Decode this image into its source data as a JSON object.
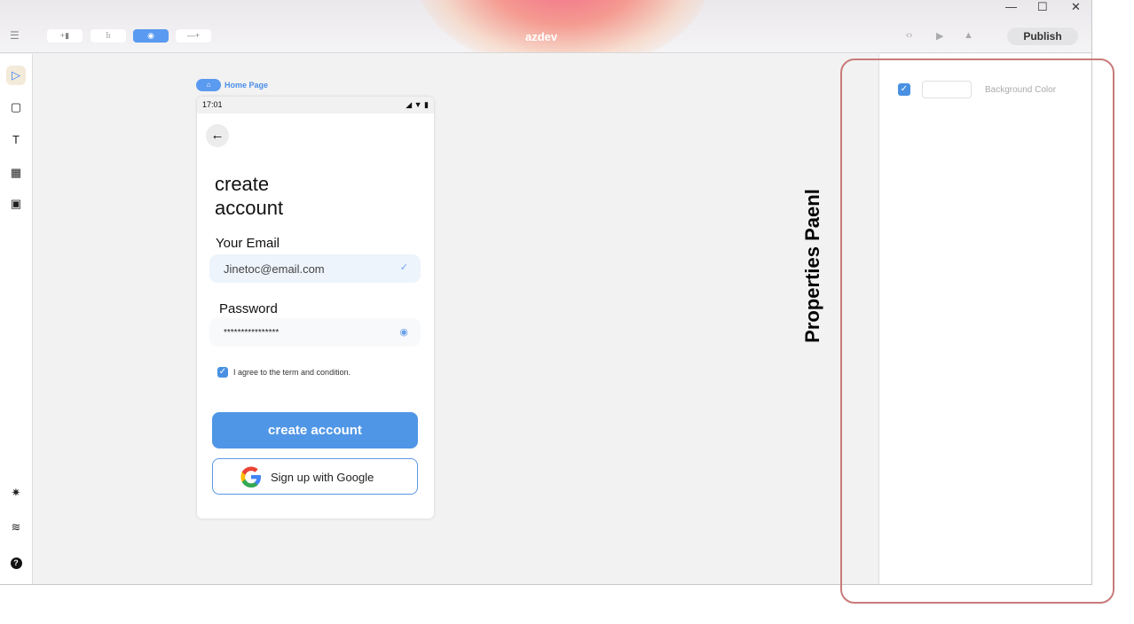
{
  "app": {
    "brand": "azdev"
  },
  "toolbar": {
    "buttons": [
      {
        "icon": "add-component-icon",
        "glyph": "+▮"
      },
      {
        "icon": "flow-icon",
        "glyph": "⠷"
      },
      {
        "icon": "preview-eye-icon",
        "glyph": "◉"
      },
      {
        "icon": "add-icon",
        "glyph": "—+"
      }
    ],
    "publish_label": "Publish",
    "icons": {
      "code": "‹›",
      "run": "▶",
      "warning": "▲"
    }
  },
  "window": {
    "minimize": "—",
    "maximize": "☐",
    "close": "✕"
  },
  "sidebar": {
    "items": [
      {
        "name": "select",
        "glyph": "▷"
      },
      {
        "name": "rectangle",
        "glyph": "▢"
      },
      {
        "name": "text",
        "glyph": "T"
      },
      {
        "name": "layout",
        "glyph": "▦"
      },
      {
        "name": "save",
        "glyph": "▣"
      },
      {
        "name": "effects",
        "glyph": "✷"
      },
      {
        "name": "layers",
        "glyph": "≋"
      },
      {
        "name": "help",
        "glyph": "?"
      }
    ]
  },
  "canvas": {
    "page_label": "Home Page"
  },
  "phone": {
    "time": "17:01",
    "signal": "◢ ▼ ▮",
    "title_line1": "create",
    "title_line2": "account",
    "email_label": "Your Email",
    "email_value": "Jinetoc@email.com",
    "password_label": "Password",
    "password_value": "****************",
    "agree_text": "I agree to the term and condition.",
    "create_button": "create account",
    "google_button": "Sign up with Google"
  },
  "properties": {
    "background_color_label": "Background Color",
    "background_enabled": true
  },
  "annotation": {
    "label": "Properties Paenl",
    "color": "#c97a7a"
  },
  "colors": {
    "accent": "#5096e6"
  }
}
